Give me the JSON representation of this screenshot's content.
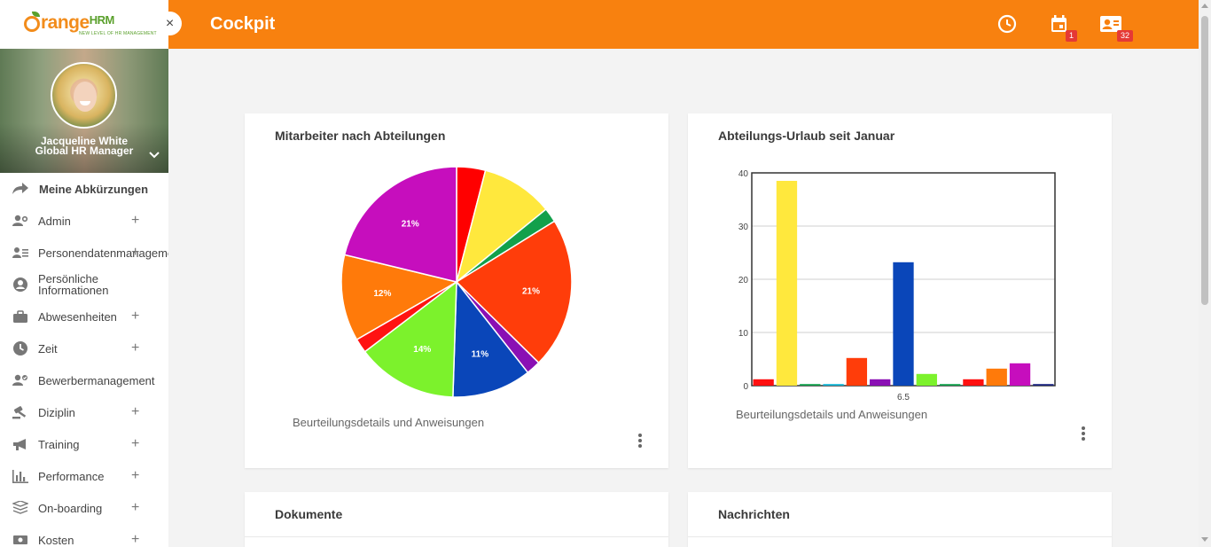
{
  "app": {
    "logo_main": "range",
    "logo_hrm": "HRM",
    "logo_tagline": "NEW LEVEL OF HR MANAGEMENT",
    "close_glyph": "×"
  },
  "profile": {
    "name": "Jacqueline White",
    "role": "Global HR Manager"
  },
  "menu": {
    "shortcuts_label": "Meine Abkürzungen",
    "items": [
      {
        "label": "Admin",
        "icon": "users-gear-icon",
        "expandable": true
      },
      {
        "label": "Personendatenmanagement",
        "icon": "user-list-icon",
        "expandable": true
      },
      {
        "label": "Persönliche Informationen",
        "icon": "user-circle-icon",
        "expandable": false
      },
      {
        "label": "Abwesenheiten",
        "icon": "briefcase-icon",
        "expandable": true
      },
      {
        "label": "Zeit",
        "icon": "clock-icon",
        "expandable": true
      },
      {
        "label": "Bewerbermanagement",
        "icon": "user-check-icon",
        "expandable": false
      },
      {
        "label": "Diziplin",
        "icon": "gavel-icon",
        "expandable": true
      },
      {
        "label": "Training",
        "icon": "megaphone-icon",
        "expandable": true
      },
      {
        "label": "Performance",
        "icon": "bar-chart-icon",
        "expandable": true
      },
      {
        "label": "On-boarding",
        "icon": "layers-icon",
        "expandable": true
      },
      {
        "label": "Kosten",
        "icon": "money-icon",
        "expandable": true
      }
    ],
    "plus_glyph": "+"
  },
  "header": {
    "title": "Cockpit",
    "calendar_badge": "1",
    "contacts_badge": "32"
  },
  "colors": {
    "header_bg": "#f8810f",
    "badge": "#e53935"
  },
  "cards": {
    "pie": {
      "title": "Mitarbeiter nach Abteilungen",
      "caption": "Beurteilungsdetails und Anweisungen"
    },
    "bar": {
      "title": "Abteilungs-Urlaub seit Januar",
      "caption": "Beurteilungsdetails und Anweisungen"
    },
    "documents": {
      "title": "Dokumente"
    },
    "messages": {
      "title": "Nachrichten"
    }
  },
  "chart_data": [
    {
      "type": "pie",
      "title": "",
      "slices": [
        {
          "value": 4,
          "color": "#ff0000",
          "label": ""
        },
        {
          "value": 10,
          "color": "#ffe83d",
          "label": ""
        },
        {
          "value": 2,
          "color": "#12a04b",
          "label": ""
        },
        {
          "value": 21,
          "color": "#ff3d0a",
          "label": "21%"
        },
        {
          "value": 2,
          "color": "#8a10b4",
          "label": ""
        },
        {
          "value": 11,
          "color": "#0a46b9",
          "label": "11%"
        },
        {
          "value": 14,
          "color": "#7cf22c",
          "label": "14%"
        },
        {
          "value": 2,
          "color": "#ff1212",
          "label": ""
        },
        {
          "value": 12,
          "color": "#ff7a0a",
          "label": "12%"
        },
        {
          "value": 21,
          "color": "#c60ebd",
          "label": "21%"
        }
      ]
    },
    {
      "type": "bar",
      "title": "",
      "categories": [
        "6.5"
      ],
      "ylim": [
        0,
        40
      ],
      "yticks": [
        "0",
        "10",
        "20",
        "30",
        "40"
      ],
      "grid": true,
      "series": [
        {
          "value": 1.2,
          "color": "#ff1010"
        },
        {
          "value": 38.5,
          "color": "#ffe83d"
        },
        {
          "value": 0.3,
          "color": "#12a04b"
        },
        {
          "value": 0.3,
          "color": "#10b4d4"
        },
        {
          "value": 5.2,
          "color": "#ff3d0a"
        },
        {
          "value": 1.2,
          "color": "#8a10b4"
        },
        {
          "value": 23.2,
          "color": "#0a46b9"
        },
        {
          "value": 2.2,
          "color": "#7cf22c"
        },
        {
          "value": 0.3,
          "color": "#12a04b"
        },
        {
          "value": 1.2,
          "color": "#ff1010"
        },
        {
          "value": 3.2,
          "color": "#ff7a0a"
        },
        {
          "value": 4.2,
          "color": "#c60ebd"
        },
        {
          "value": 0.3,
          "color": "#1a237e"
        }
      ]
    }
  ]
}
